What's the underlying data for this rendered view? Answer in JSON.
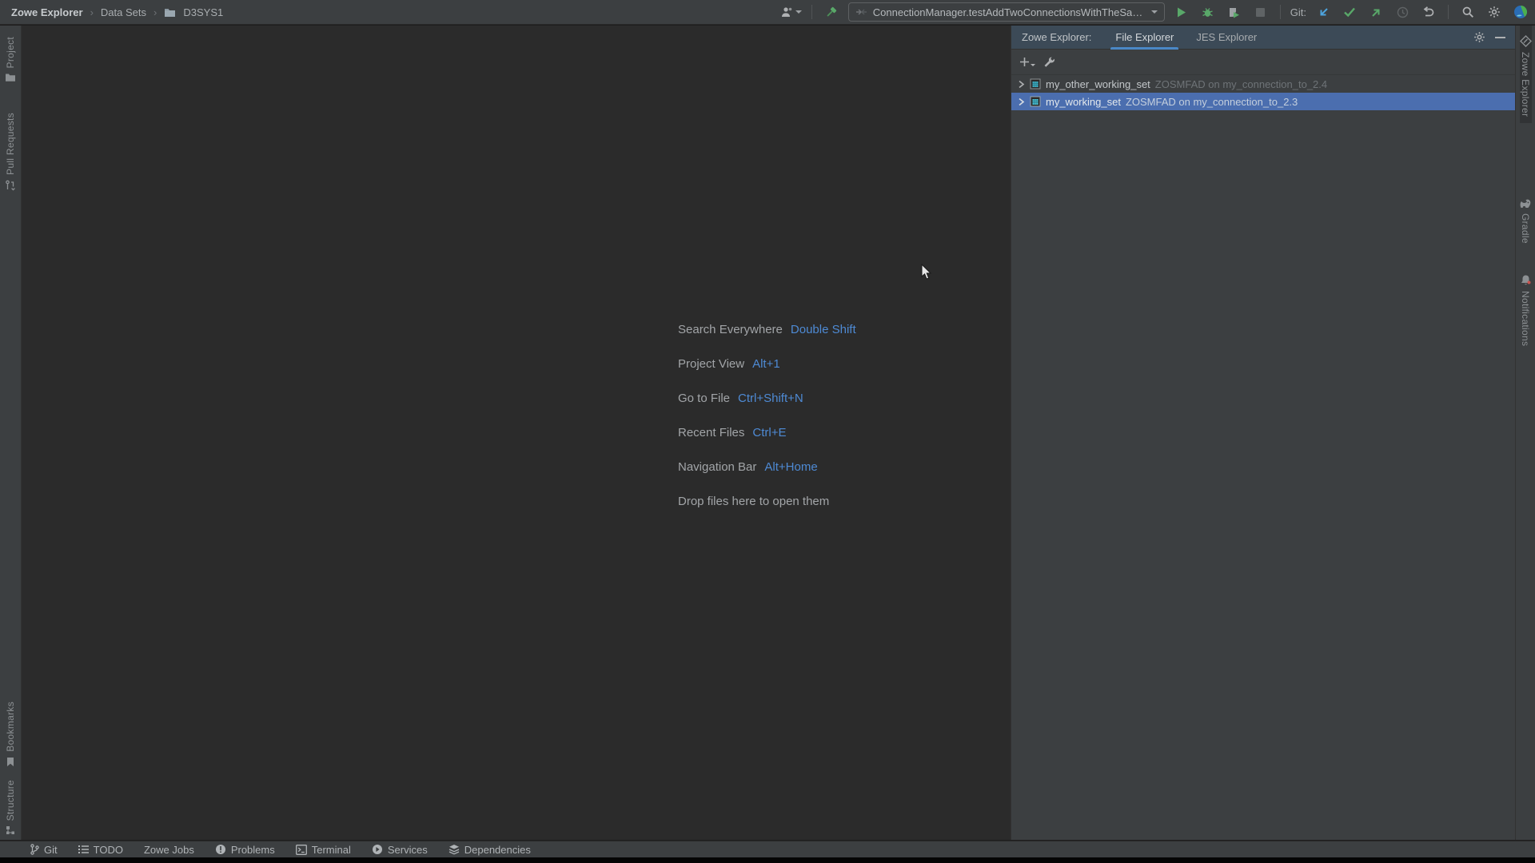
{
  "breadcrumb": {
    "root": "Zowe Explorer",
    "section": "Data Sets",
    "item": "D3SYS1",
    "separator": "›"
  },
  "topbar": {
    "run_config": "ConnectionManager.testAddTwoConnectionsWithTheSameName",
    "git_label": "Git:"
  },
  "left_stripe": {
    "project": "Project",
    "pull_requests": "Pull Requests",
    "bookmarks": "Bookmarks",
    "structure": "Structure"
  },
  "right_stripe": {
    "zowe_explorer": "Zowe Explorer",
    "gradle": "Gradle",
    "notifications": "Notifications"
  },
  "panel": {
    "title": "Zowe Explorer:",
    "tabs": [
      {
        "label": "File Explorer",
        "active": true
      },
      {
        "label": "JES Explorer",
        "active": false
      }
    ],
    "tree": [
      {
        "name": "my_other_working_set",
        "detail": "ZOSMFAD on my_connection_to_2.4",
        "selected": false
      },
      {
        "name": "my_working_set",
        "detail": "ZOSMFAD on my_connection_to_2.3",
        "selected": true
      }
    ]
  },
  "editor": {
    "shortcuts": [
      {
        "label": "Search Everywhere",
        "keys": "Double Shift"
      },
      {
        "label": "Project View",
        "keys": "Alt+1"
      },
      {
        "label": "Go to File",
        "keys": "Ctrl+Shift+N"
      },
      {
        "label": "Recent Files",
        "keys": "Ctrl+E"
      },
      {
        "label": "Navigation Bar",
        "keys": "Alt+Home"
      }
    ],
    "drop_hint": "Drop files here to open them"
  },
  "status_bar": {
    "items": [
      "Git",
      "TODO",
      "Zowe Jobs",
      "Problems",
      "Terminal",
      "Services",
      "Dependencies"
    ]
  },
  "colors": {
    "topbar_bg": "#3c3f41",
    "editor_bg": "#2b2b2b",
    "panel_header_bg": "#3c4a57",
    "tab_underline": "#4a88c7",
    "selection_blue": "#4b6eaf",
    "shortcut_key_blue": "#4e8ad4",
    "run_green": "#59a869",
    "vcs_update_blue": "#4da3dd",
    "notification_dot_red": "#c75450"
  }
}
